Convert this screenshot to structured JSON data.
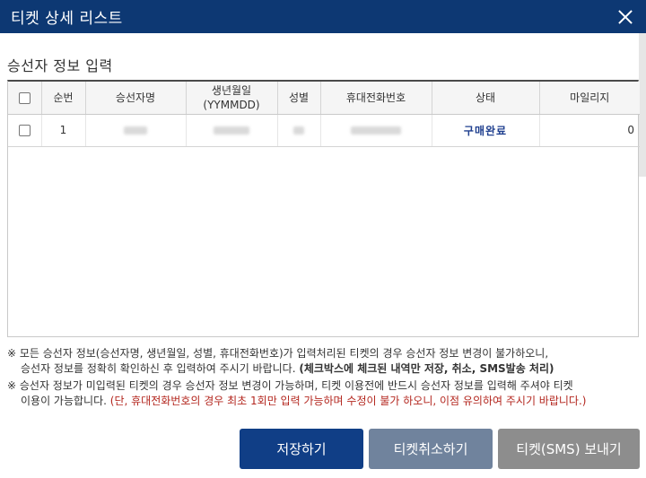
{
  "window": {
    "title": "티켓 상세 리스트"
  },
  "section": {
    "title": "승선자 정보 입력"
  },
  "table": {
    "headers": [
      "순번",
      "승선자명",
      "생년월일\n(YYMMDD)",
      "성별",
      "휴대전화번호",
      "상태",
      "마일리지"
    ],
    "rows": [
      {
        "seq": "1",
        "status": "구매완료",
        "mileage": "0"
      }
    ]
  },
  "notes": {
    "n1_line1": "※ 모든 승선자 정보(승선자명, 생년월일, 성별, 휴대전화번호)가 입력처리된 티켓의 경우 승선자 정보 변경이 불가하오니,",
    "n1_line2": "승선자 정보를 정확히 확인하신 후 입력하여 주시기 바랍니다.",
    "n1_bold": "(체크박스에 체크된 내역만 저장, 취소, SMS발송 처리)",
    "n2_line1": "※ 승선자 정보가 미입력된 티켓의 경우 승선자 정보 변경이 가능하며, 티켓 이용전에 반드시 승선자 정보를 입력해 주셔야 티켓",
    "n2_line2": "이용이 가능합니다.",
    "n2_red": "(단, 휴대전화번호의 경우 최초 1회만 입력 가능하며 수정이 불가 하오니, 이점 유의하여 주시기 바랍니다.)"
  },
  "buttons": {
    "save": "저장하기",
    "cancel": "티켓취소하기",
    "sms": "티켓(SMS) 보내기"
  },
  "colors": {
    "titlebar": "#0d3873",
    "save": "#103e86",
    "cancel": "#70839d",
    "sms": "#8d8d8d",
    "status": "#1f3f8f",
    "warning": "#b3261e"
  }
}
